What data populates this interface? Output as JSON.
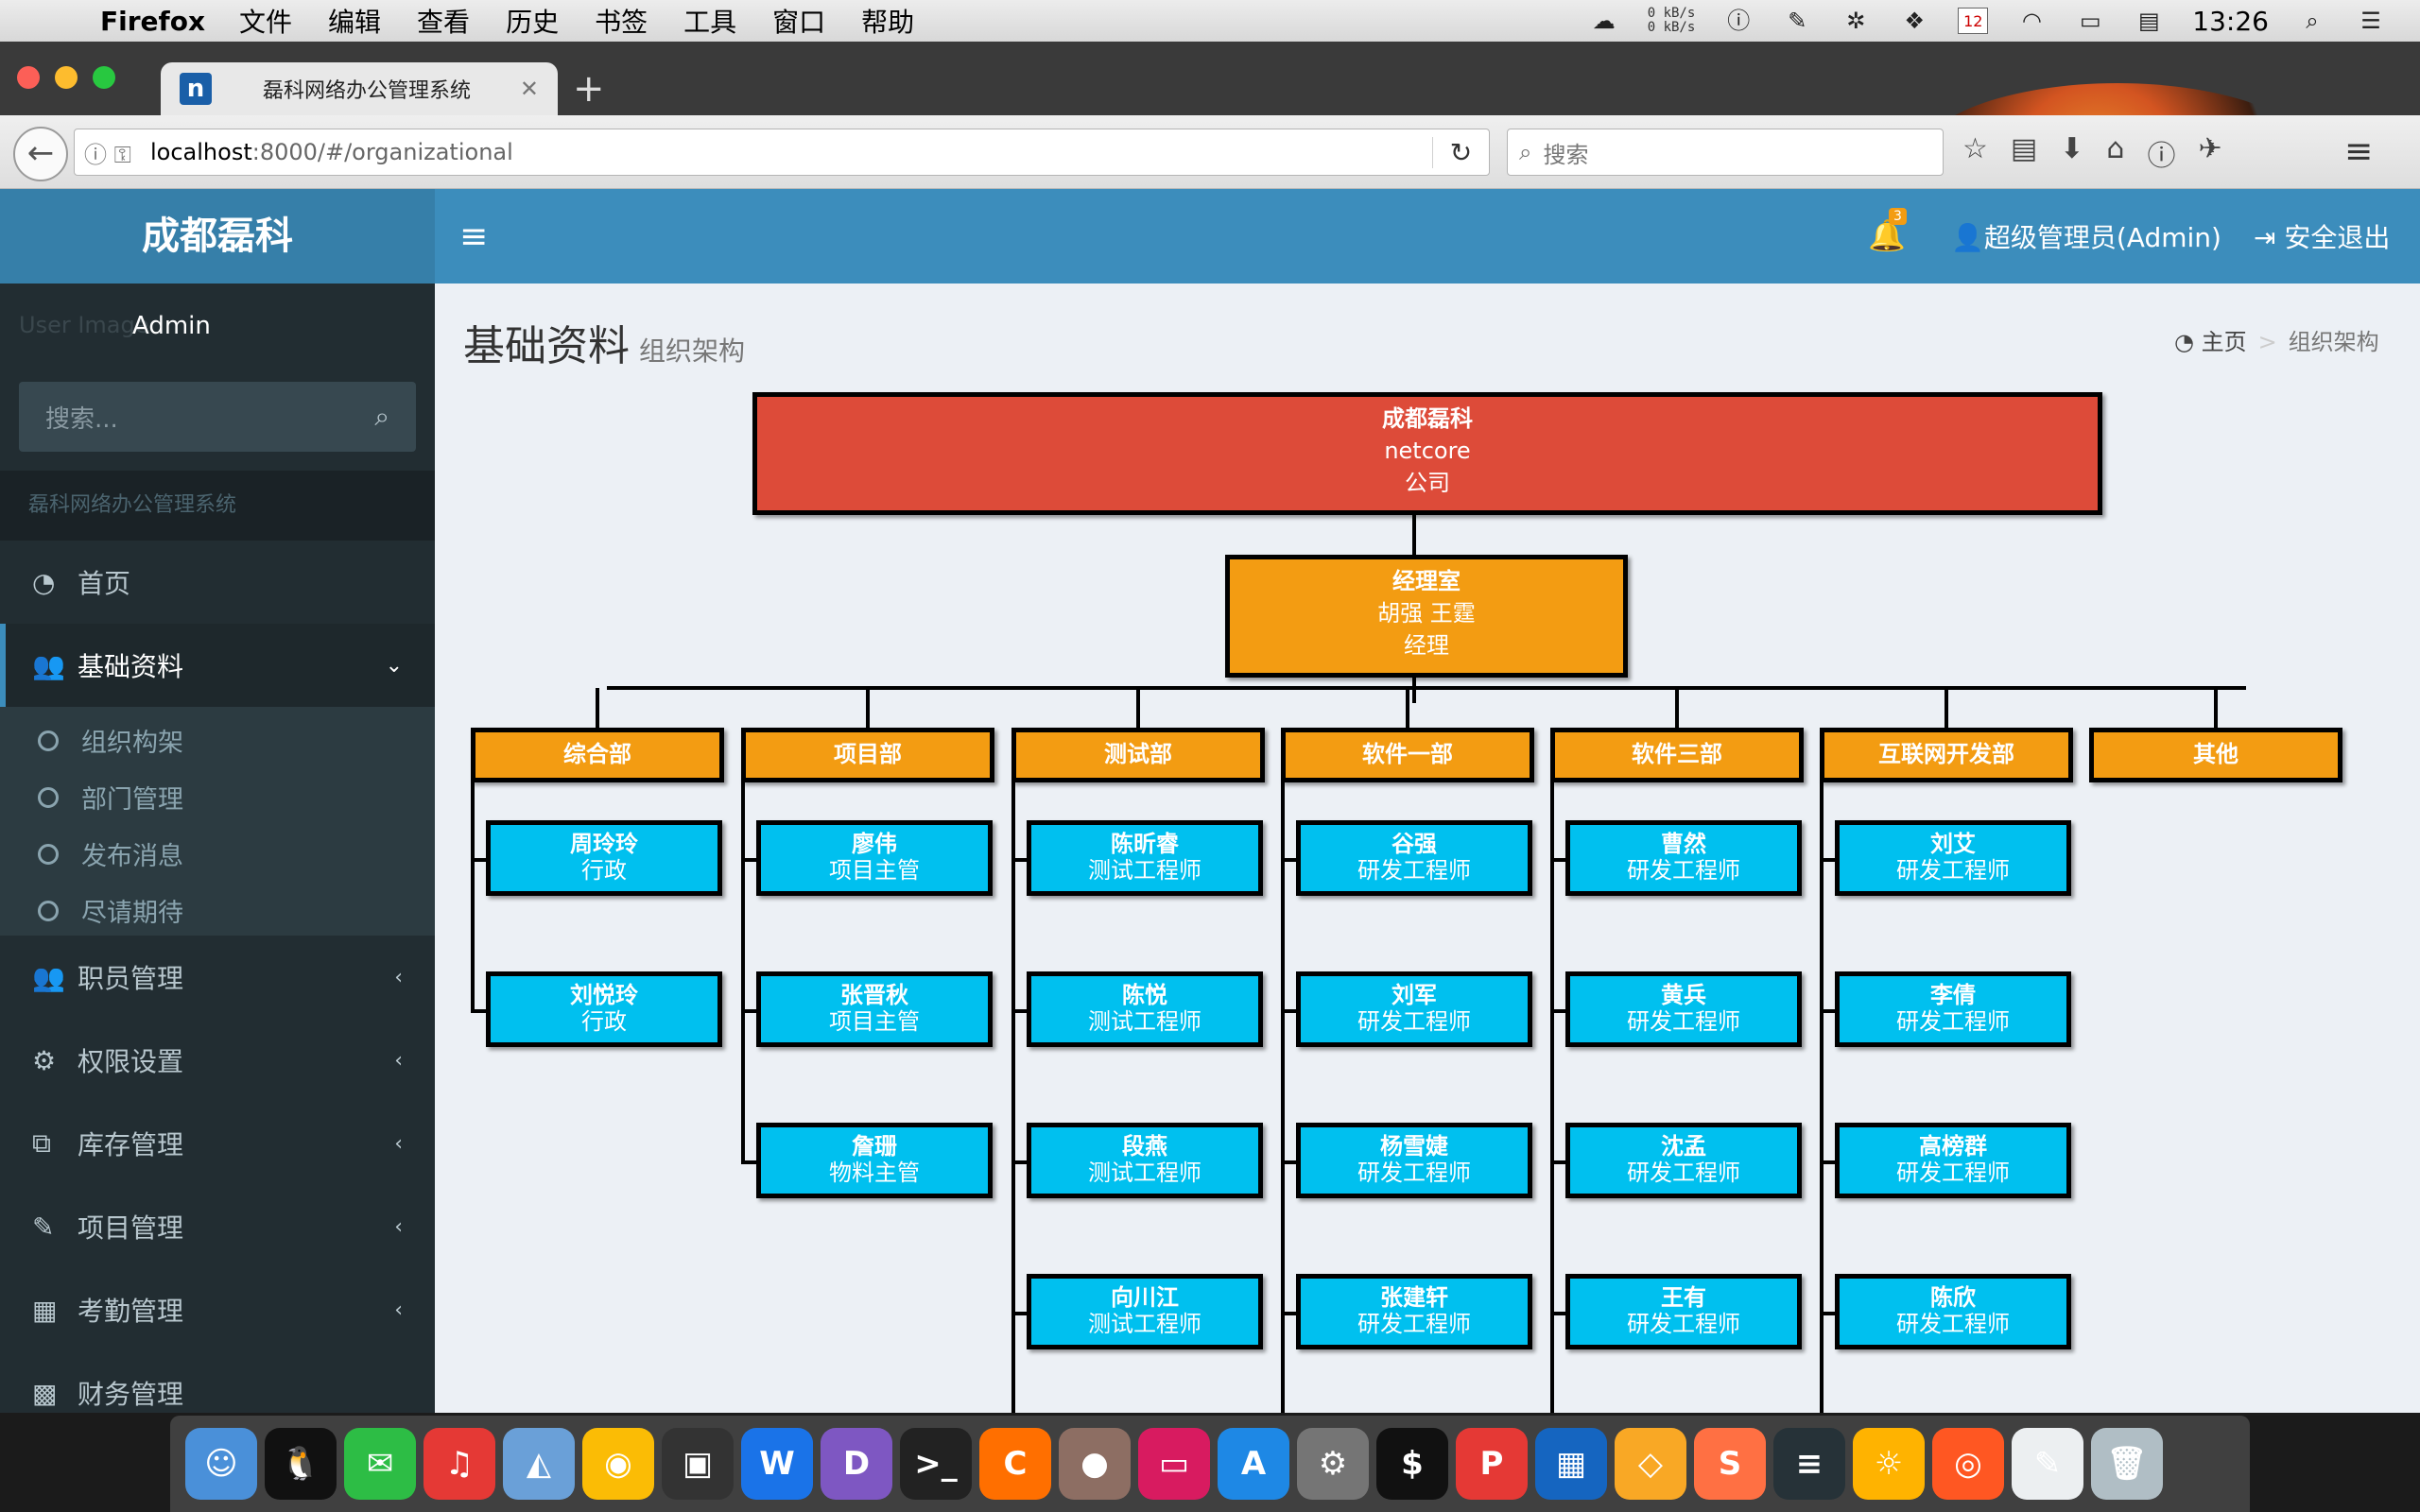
{
  "menubar": {
    "app_name": "Firefox",
    "menus": [
      "文件",
      "编辑",
      "查看",
      "历史",
      "书签",
      "工具",
      "窗口",
      "帮助"
    ],
    "net_up": "0 kB/s",
    "net_down": "0 kB/s",
    "calendar_day": "12",
    "time": "13:26"
  },
  "browser": {
    "tab_title": "磊科网络办公管理系统",
    "tab_favicon": "n",
    "url_host": "localhost",
    "url_rest": ":8000/#/organizational",
    "search_placeholder": "搜索"
  },
  "app": {
    "logo": "成都磊科",
    "notification_count": "3",
    "user_label": "超级管理员(Admin)",
    "logout_label": "安全退出",
    "accent_color": "#3c8dbc"
  },
  "sidebar": {
    "user_image_alt": "User Image",
    "user_name": "Admin",
    "search_placeholder": "搜索...",
    "header": "磊科网络办公管理系统",
    "items": [
      {
        "label": "首页",
        "icon": "dashboard-icon"
      },
      {
        "label": "基础资料",
        "icon": "users-icon"
      },
      {
        "label": "职员管理",
        "icon": "users-icon"
      },
      {
        "label": "权限设置",
        "icon": "gear-icon"
      },
      {
        "label": "库存管理",
        "icon": "copy-icon"
      },
      {
        "label": "项目管理",
        "icon": "edit-icon"
      },
      {
        "label": "考勤管理",
        "icon": "table-icon"
      },
      {
        "label": "财务管理",
        "icon": "grid-icon"
      }
    ],
    "subitems": [
      "组织构架",
      "部门管理",
      "发布消息",
      "尽请期待"
    ]
  },
  "content": {
    "title": "基础资料",
    "subtitle": "组织架构",
    "breadcrumb_home": "主页",
    "breadcrumb_current": "组织架构"
  },
  "org": {
    "root": {
      "name": "成都磊科",
      "code": "netcore",
      "type": "公司"
    },
    "manager": {
      "name": "经理室",
      "people": "胡强 王霆",
      "role": "经理"
    },
    "departments": [
      {
        "name": "综合部",
        "employees": [
          {
            "name": "周玲玲",
            "role": "行政"
          },
          {
            "name": "刘悦玲",
            "role": "行政"
          }
        ]
      },
      {
        "name": "项目部",
        "employees": [
          {
            "name": "廖伟",
            "role": "项目主管"
          },
          {
            "name": "张晋秋",
            "role": "项目主管"
          },
          {
            "name": "詹珊",
            "role": "物料主管"
          }
        ]
      },
      {
        "name": "测试部",
        "employees": [
          {
            "name": "陈昕睿",
            "role": "测试工程师"
          },
          {
            "name": "陈悦",
            "role": "测试工程师"
          },
          {
            "name": "段燕",
            "role": "测试工程师"
          },
          {
            "name": "向川江",
            "role": "测试工程师"
          }
        ]
      },
      {
        "name": "软件一部",
        "employees": [
          {
            "name": "谷强",
            "role": "研发工程师"
          },
          {
            "name": "刘军",
            "role": "研发工程师"
          },
          {
            "name": "杨雪婕",
            "role": "研发工程师"
          },
          {
            "name": "张建轩",
            "role": "研发工程师"
          }
        ]
      },
      {
        "name": "软件三部",
        "employees": [
          {
            "name": "曹然",
            "role": "研发工程师"
          },
          {
            "name": "黄兵",
            "role": "研发工程师"
          },
          {
            "name": "沈孟",
            "role": "研发工程师"
          },
          {
            "name": "王有",
            "role": "研发工程师"
          }
        ]
      },
      {
        "name": "互联网开发部",
        "employees": [
          {
            "name": "刘艾",
            "role": "研发工程师"
          },
          {
            "name": "李倩",
            "role": "研发工程师"
          },
          {
            "name": "高榜群",
            "role": "研发工程师"
          },
          {
            "name": "陈欣",
            "role": "研发工程师"
          }
        ]
      },
      {
        "name": "其他",
        "employees": []
      }
    ],
    "colors": {
      "root": "#dd4b39",
      "dept": "#f39c12",
      "employee": "#00c0ef"
    }
  },
  "dock": {
    "apps": [
      "finder-icon",
      "qq-icon",
      "wechat-icon",
      "netease-music-icon",
      "preview-icon",
      "chrome-icon",
      "code-editor-icon",
      "webstorm-icon",
      "dash-icon",
      "terminal-icon",
      "clion-icon",
      "cake-icon",
      "display-icon",
      "app-store-icon",
      "system-preferences-icon",
      "iterm-icon",
      "pdf-icon",
      "grid-app-icon",
      "sketch-icon",
      "sublime-text-icon",
      "script-icon",
      "balloon-icon",
      "firefox-icon",
      "textedit-icon",
      "trash-icon"
    ]
  }
}
